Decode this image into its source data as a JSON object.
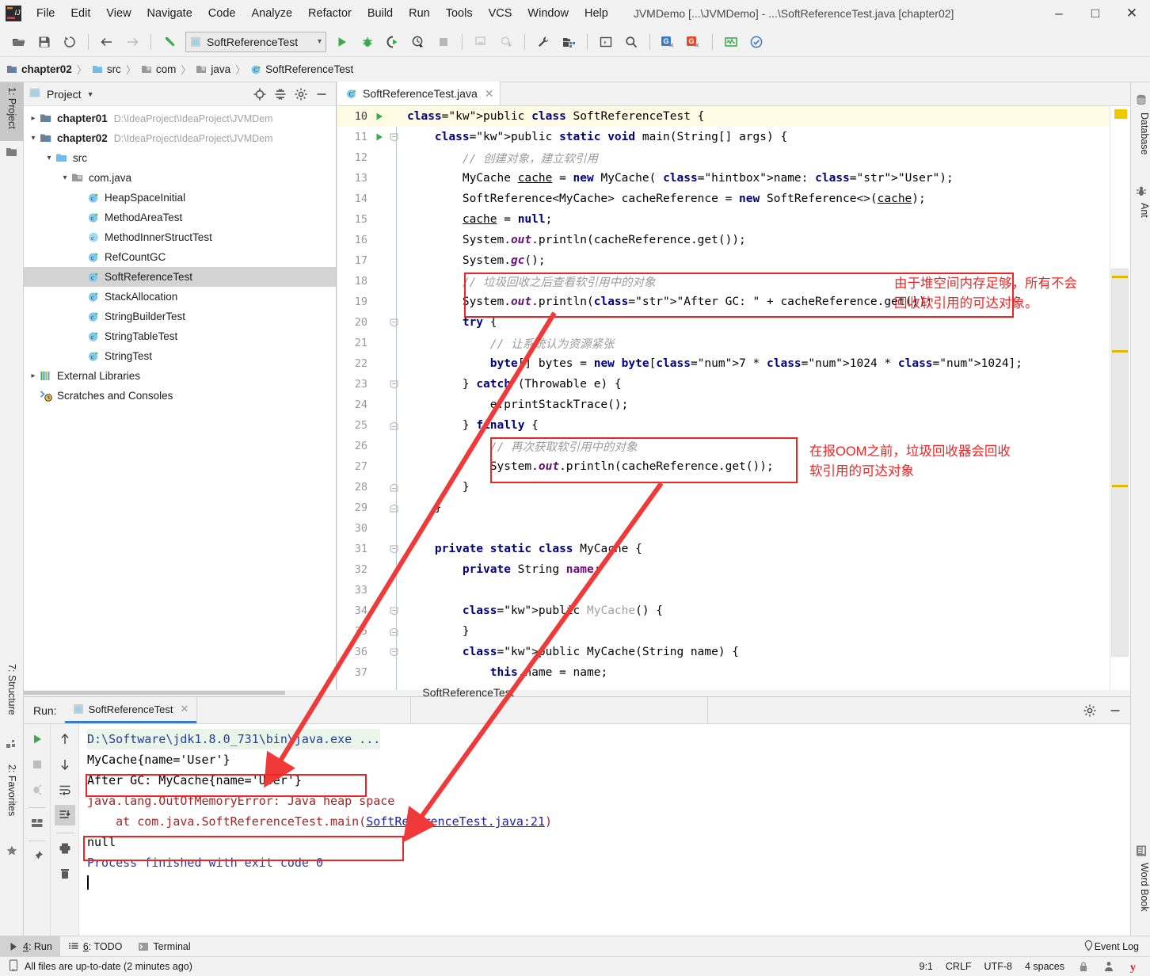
{
  "window": {
    "title": "JVMDemo [...\\JVMDemo] - ...\\SoftReferenceTest.java [chapter02]",
    "minimize": "–",
    "maximize": "□",
    "close": "✕"
  },
  "menu": [
    "File",
    "Edit",
    "View",
    "Navigate",
    "Code",
    "Analyze",
    "Refactor",
    "Build",
    "Run",
    "Tools",
    "VCS",
    "Window",
    "Help"
  ],
  "toolbar": {
    "run_config": "SoftReferenceTest",
    "icons": [
      "open-folder-icon",
      "save-all-icon",
      "sync-refresh-icon",
      "back-arrow-icon",
      "forward-arrow-icon",
      "undo-icon",
      "run-icon",
      "debug-icon",
      "run-coverage-icon",
      "profiler-icon",
      "stop-icon",
      "build-project-icon",
      "build-module-icon",
      "settings-wrench-icon",
      "project-structure-icon",
      "terminal-icon",
      "search-everywhere-icon",
      "translate-blue-icon",
      "translate-red-icon",
      "monitor-icon",
      "check-circle-icon"
    ]
  },
  "breadcrumb": [
    {
      "label": "chapter02",
      "icon": "module-icon",
      "bold": true
    },
    {
      "label": "src",
      "icon": "source-folder-icon",
      "bold": false
    },
    {
      "label": "com",
      "icon": "package-icon",
      "bold": false
    },
    {
      "label": "java",
      "icon": "package-icon",
      "bold": false
    },
    {
      "label": "SoftReferenceTest",
      "icon": "java-class-icon",
      "bold": false
    }
  ],
  "left_rail": [
    {
      "label": "1: Project",
      "icon": "project-icon",
      "selected": true
    },
    {
      "label": "7: Structure",
      "icon": "structure-icon",
      "selected": false
    },
    {
      "label": "2: Favorites",
      "icon": "star-icon",
      "selected": false
    }
  ],
  "right_rail": [
    {
      "label": "Database",
      "icon": "database-icon"
    },
    {
      "label": "Ant",
      "icon": "ant-icon"
    },
    {
      "label": "Word Book",
      "icon": "book-icon"
    }
  ],
  "project_panel": {
    "title": "Project",
    "header_icons": [
      "locate-icon",
      "collapse-all-icon",
      "gear-icon",
      "hide-icon"
    ],
    "tree": [
      {
        "indent": 0,
        "arrow": "▸",
        "icon": "module-icon",
        "label": "chapter01",
        "bold": true,
        "path": "D:\\IdeaProject\\IdeaProject\\JVMDem",
        "selected": false
      },
      {
        "indent": 0,
        "arrow": "▾",
        "icon": "module-icon",
        "label": "chapter02",
        "bold": true,
        "path": "D:\\IdeaProject\\IdeaProject\\JVMDem",
        "selected": false
      },
      {
        "indent": 1,
        "arrow": "▾",
        "icon": "source-folder-icon",
        "label": "src",
        "bold": false,
        "path": "",
        "selected": false
      },
      {
        "indent": 2,
        "arrow": "▾",
        "icon": "package-icon",
        "label": "com.java",
        "bold": false,
        "path": "",
        "selected": false
      },
      {
        "indent": 3,
        "arrow": "",
        "icon": "java-class-runnable-icon",
        "label": "HeapSpaceInitial",
        "bold": false,
        "path": "",
        "selected": false
      },
      {
        "indent": 3,
        "arrow": "",
        "icon": "java-class-runnable-icon",
        "label": "MethodAreaTest",
        "bold": false,
        "path": "",
        "selected": false
      },
      {
        "indent": 3,
        "arrow": "",
        "icon": "java-class-icon",
        "label": "MethodInnerStructTest",
        "bold": false,
        "path": "",
        "selected": false
      },
      {
        "indent": 3,
        "arrow": "",
        "icon": "java-class-runnable-icon",
        "label": "RefCountGC",
        "bold": false,
        "path": "",
        "selected": false
      },
      {
        "indent": 3,
        "arrow": "",
        "icon": "java-class-runnable-icon",
        "label": "SoftReferenceTest",
        "bold": false,
        "path": "",
        "selected": true
      },
      {
        "indent": 3,
        "arrow": "",
        "icon": "java-class-runnable-icon",
        "label": "StackAllocation",
        "bold": false,
        "path": "",
        "selected": false
      },
      {
        "indent": 3,
        "arrow": "",
        "icon": "java-class-runnable-icon",
        "label": "StringBuilderTest",
        "bold": false,
        "path": "",
        "selected": false
      },
      {
        "indent": 3,
        "arrow": "",
        "icon": "java-class-runnable-icon",
        "label": "StringTableTest",
        "bold": false,
        "path": "",
        "selected": false
      },
      {
        "indent": 3,
        "arrow": "",
        "icon": "java-class-runnable-icon",
        "label": "StringTest",
        "bold": false,
        "path": "",
        "selected": false
      },
      {
        "indent": 0,
        "arrow": "▸",
        "icon": "libraries-icon",
        "label": "External Libraries",
        "bold": false,
        "path": "",
        "selected": false
      },
      {
        "indent": 0,
        "arrow": "",
        "icon": "scratches-icon",
        "label": "Scratches and Consoles",
        "bold": false,
        "path": "",
        "selected": false
      }
    ]
  },
  "editor": {
    "tab": "SoftReferenceTest.java",
    "first_line": 10,
    "lines": [
      {
        "n": 10,
        "run": true,
        "text": "public class SoftReferenceTest {"
      },
      {
        "n": 11,
        "run": true,
        "text": "    public static void main(String[] args) {"
      },
      {
        "n": 12,
        "run": false,
        "text": "        // 创建对象，建立软引用"
      },
      {
        "n": 13,
        "run": false,
        "text": "        MyCache cache = new MyCache( name: \"User\");"
      },
      {
        "n": 14,
        "run": false,
        "text": "        SoftReference<MyCache> cacheReference = new SoftReference<>(cache);"
      },
      {
        "n": 15,
        "run": false,
        "text": "        cache = null;"
      },
      {
        "n": 16,
        "run": false,
        "text": "        System.out.println(cacheReference.get());"
      },
      {
        "n": 17,
        "run": false,
        "text": "        System.gc();"
      },
      {
        "n": 18,
        "run": false,
        "text": "        // 垃圾回收之后查看软引用中的对象"
      },
      {
        "n": 19,
        "run": false,
        "text": "        System.out.println(\"After GC: \" + cacheReference.get());"
      },
      {
        "n": 20,
        "run": false,
        "text": "        try {"
      },
      {
        "n": 21,
        "run": false,
        "text": "            // 让系统认为资源紧张"
      },
      {
        "n": 22,
        "run": false,
        "text": "            byte[] bytes = new byte[7 * 1024 * 1024];"
      },
      {
        "n": 23,
        "run": false,
        "text": "        } catch (Throwable e) {"
      },
      {
        "n": 24,
        "run": false,
        "text": "            e.printStackTrace();"
      },
      {
        "n": 25,
        "run": false,
        "text": "        } finally {"
      },
      {
        "n": 26,
        "run": false,
        "text": "            // 再次获取软引用中的对象"
      },
      {
        "n": 27,
        "run": false,
        "text": "            System.out.println(cacheReference.get());"
      },
      {
        "n": 28,
        "run": false,
        "text": "        }"
      },
      {
        "n": 29,
        "run": false,
        "text": "    }"
      },
      {
        "n": 30,
        "run": false,
        "text": ""
      },
      {
        "n": 31,
        "run": false,
        "text": "    private static class MyCache {"
      },
      {
        "n": 32,
        "run": false,
        "text": "        private String name;"
      },
      {
        "n": 33,
        "run": false,
        "text": ""
      },
      {
        "n": 34,
        "run": false,
        "text": "        public MyCache() {"
      },
      {
        "n": 35,
        "run": false,
        "text": "        }"
      },
      {
        "n": 36,
        "run": false,
        "text": "        public MyCache(String name) {"
      },
      {
        "n": 37,
        "run": false,
        "text": "            this.name = name;"
      }
    ],
    "center_title": "SoftReferenceTest"
  },
  "annotations": {
    "note1": "由于堆空间内存足够，所有不会\n回收软引用的可达对象。",
    "note2": "在报OOM之前，垃圾回收器会回收\n软引用的可达对象",
    "color": "#ef2525"
  },
  "run_panel": {
    "label": "Run:",
    "tab": "SoftReferenceTest",
    "sidebar_icons": [
      "rerun-icon",
      "stop-icon",
      "rerun-failed-icon",
      "layout-icon",
      "pin-icon"
    ],
    "sidebar2_icons": [
      "up-arrow-icon",
      "down-arrow-icon",
      "soft-wrap-icon",
      "scroll-to-end-icon",
      "print-icon",
      "trash-icon"
    ],
    "header_icons": [
      "gear-icon",
      "hide-icon"
    ],
    "console": [
      {
        "text": "D:\\Software\\jdk1.8.0_731\\bin\\java.exe ...",
        "style": "cmd"
      },
      {
        "text": "MyCache{name='User'}",
        "style": "out"
      },
      {
        "text": "After GC: MyCache{name='User'}",
        "style": "out"
      },
      {
        "text": "java.lang.OutOfMemoryError: Java heap space",
        "style": "err"
      },
      {
        "text": "    at com.java.SoftReferenceTest.main(SoftReferenceTest.java:21)",
        "style": "err-link"
      },
      {
        "text": "null",
        "style": "out"
      },
      {
        "text": "",
        "style": "out"
      },
      {
        "text": "Process finished with exit code 0",
        "style": "fin"
      }
    ],
    "link_text": "SoftReferenceTest.java:21",
    "err_prefix": "    at com.java.SoftReferenceTest.main(",
    "err_suffix": ")"
  },
  "bottom_tabs": [
    {
      "num": "4",
      "label": ": Run",
      "icon": "run-icon",
      "selected": true
    },
    {
      "num": "6",
      "label": ": TODO",
      "icon": "todo-icon",
      "selected": false
    },
    {
      "num": "",
      "label": "Terminal",
      "icon": "terminal-icon",
      "selected": false
    }
  ],
  "event_log": {
    "label": "Event Log",
    "icon": "balloon-icon"
  },
  "status_bar": {
    "message": "All files are up-to-date (2 minutes ago)",
    "message_icon": "document-icon",
    "caret": "9:1",
    "line_sep": "CRLF",
    "encoding": "UTF-8",
    "indent": "4 spaces",
    "icons": [
      "lock-icon",
      "person-icon",
      "yandex-icon"
    ]
  },
  "colors": {
    "accent": "#3c7cc6",
    "annotation_red": "#ef2525",
    "keyword_blue": "#000080",
    "string_green": "#028900",
    "comment_grey": "#9b9b9b",
    "error_red": "#a32525",
    "selection_grey": "#d4d4d4"
  }
}
